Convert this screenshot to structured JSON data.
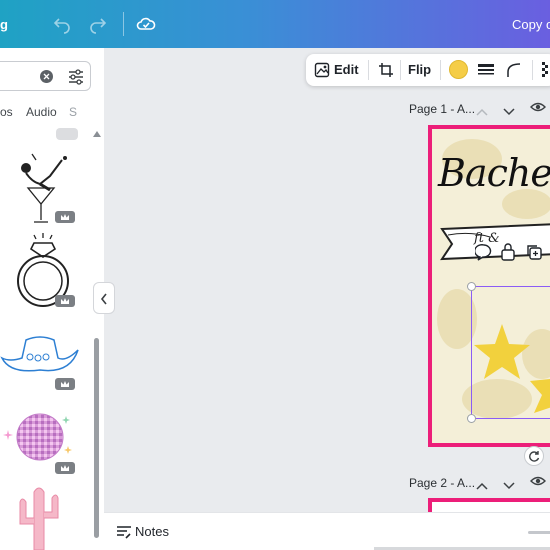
{
  "topbar": {
    "menu_fragment": "g",
    "copy_title": "Copy o"
  },
  "left_panel": {
    "tabs": [
      "os",
      "Audio",
      "S"
    ]
  },
  "toolbar": {
    "edit_label": "Edit",
    "flip_label": "Flip",
    "color_value": "#f5cd47"
  },
  "pages": {
    "page1_label": "Page 1 - A...",
    "page2_label": "Page 2 - A...",
    "title_text": "Bachel",
    "banner_text": "ft &"
  },
  "bottom": {
    "notes_label": "Notes"
  },
  "colors": {
    "accent_pink": "#ec1e79",
    "selection": "#8b5cf6",
    "star_yellow": "#f2d13d"
  }
}
